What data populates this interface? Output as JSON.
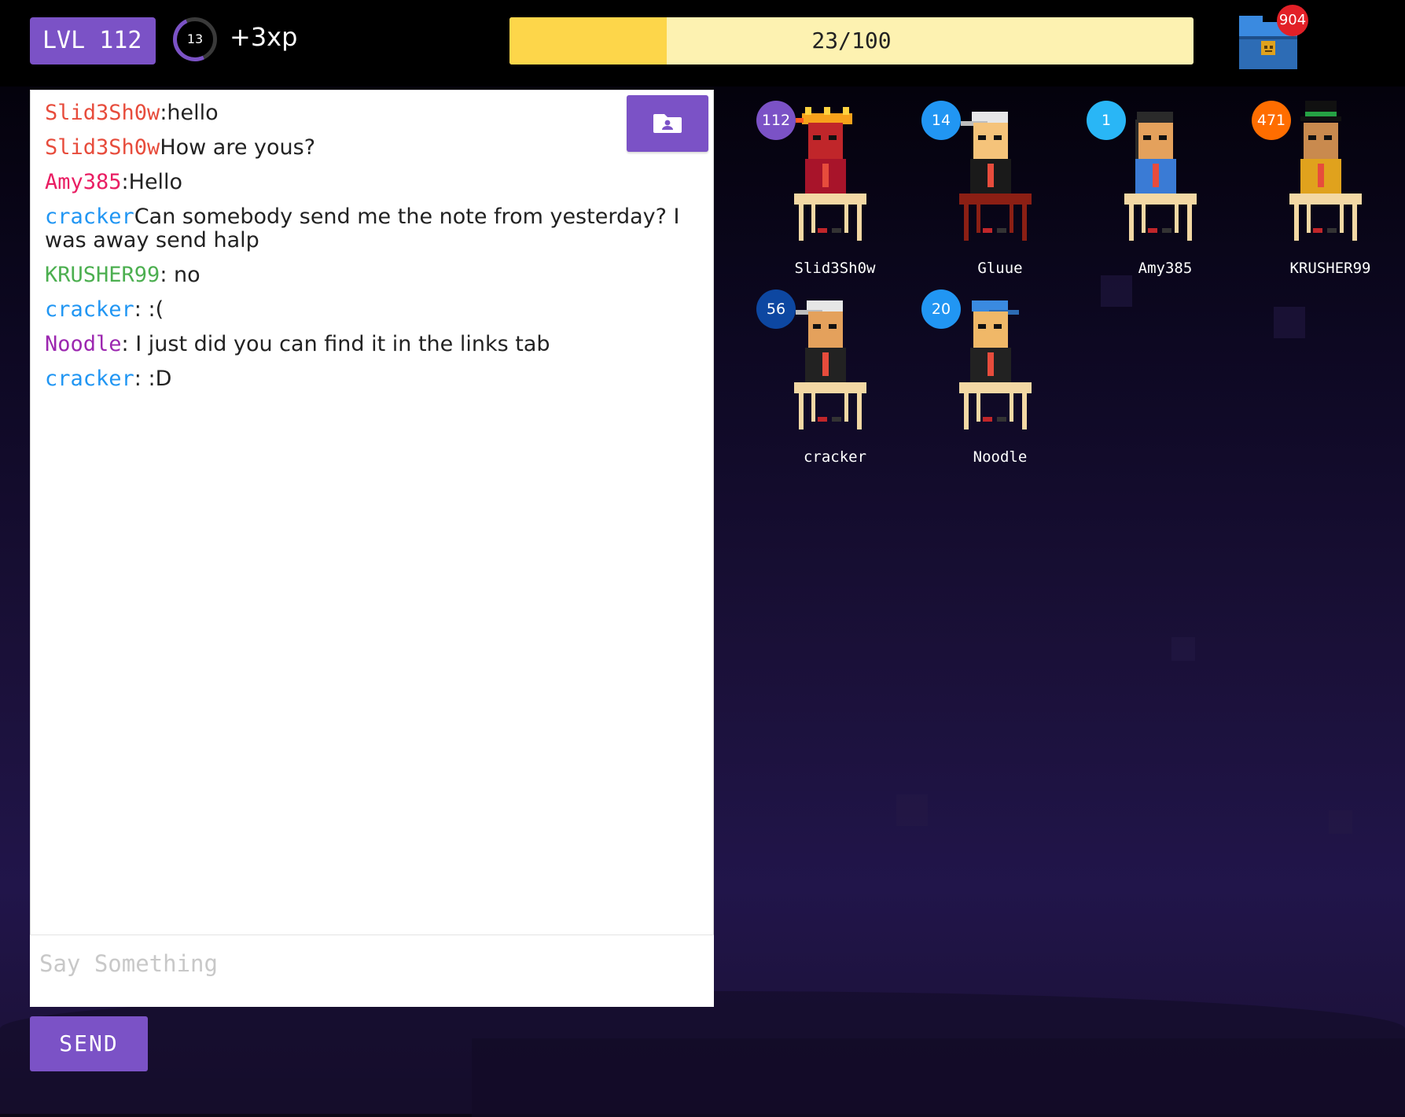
{
  "header": {
    "level_label": "LVL 112",
    "xp_count": "13",
    "xp_gain": "+3xp",
    "progress_text": "23/100",
    "progress_fraction": 0.23,
    "chest_badge": "904"
  },
  "colors": {
    "accent": "#7b52c6",
    "progress_bg": "#fdf2b1",
    "progress_fill": "#fdd64a",
    "badge_red": "#e22027"
  },
  "chat": {
    "messages": [
      {
        "user": "Slid3Sh0w",
        "text": ":hello",
        "color": "#e74c3c"
      },
      {
        "user": "Slid3Sh0w",
        "text": "How are yous?",
        "color": "#e74c3c"
      },
      {
        "user": "Amy385",
        "text": ":Hello",
        "color": "#e91e63"
      },
      {
        "user": "cracker",
        "text": "Can somebody send me the note from yesterday? I was away send halp",
        "color": "#2196f3"
      },
      {
        "user": "KRUSHER99",
        "text": ": no",
        "color": "#4caf50"
      },
      {
        "user": "cracker",
        "text": ": :(",
        "color": "#2196f3"
      },
      {
        "user": "Noodle",
        "text": ": I just did you can find it in the links tab",
        "color": "#9c27b0"
      },
      {
        "user": "cracker",
        "text": ": :D",
        "color": "#2196f3"
      }
    ],
    "input_placeholder": "Say Something",
    "send_label": "SEND",
    "folder_icon": "folder-user-icon"
  },
  "classroom": {
    "students": [
      {
        "name": "Slid3Sh0w",
        "level": "112",
        "badge_color": "#7b52c6",
        "skin": "#c0262a",
        "hat": "crown",
        "shirt": "#a8142a",
        "desk": "#f3d8a4"
      },
      {
        "name": "Gluue",
        "level": "14",
        "badge_color": "#2196f3",
        "skin": "#f5c37a",
        "hat": "cap-white",
        "shirt": "#1a1a1a",
        "desk": "#8b1f14"
      },
      {
        "name": "Amy385",
        "level": "1",
        "badge_color": "#29b6f6",
        "skin": "#e4a15c",
        "hat": "hair-dark",
        "shirt": "#3a7bd5",
        "desk": "#f3d8a4"
      },
      {
        "name": "KRUSHER99",
        "level": "471",
        "badge_color": "#ff6d00",
        "skin": "#c98a4e",
        "hat": "tophat-green",
        "shirt": "#e0a21d",
        "desk": "#f3d8a4"
      },
      {
        "name": "cracker",
        "level": "56",
        "badge_color": "#0d47a1",
        "skin": "#e4a15c",
        "hat": "cap-white",
        "shirt": "#222",
        "desk": "#f3d8a4"
      },
      {
        "name": "Noodle",
        "level": "20",
        "badge_color": "#2196f3",
        "skin": "#f0b868",
        "hat": "cap-blue",
        "shirt": "#222",
        "desk": "#f3d8a4"
      }
    ]
  }
}
